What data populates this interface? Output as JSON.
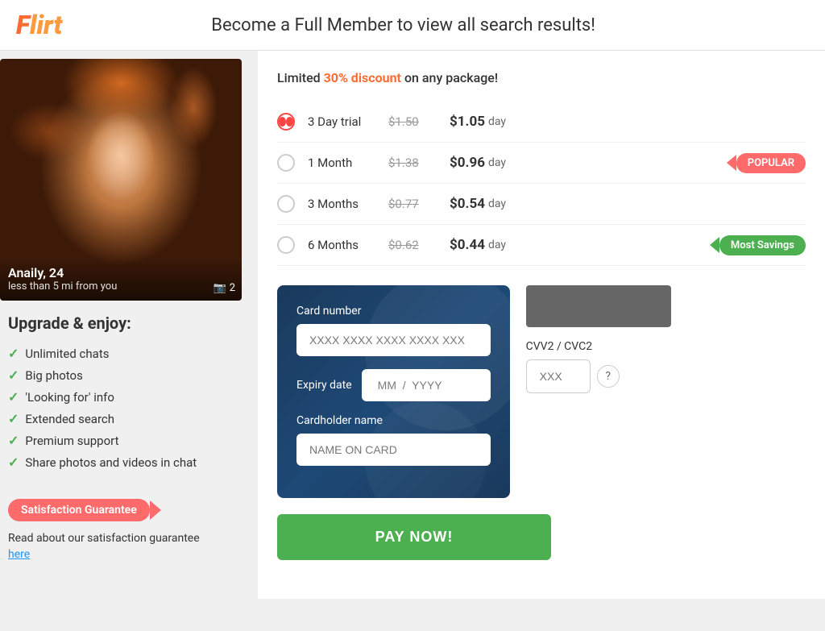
{
  "header": {
    "logo_text_f": "F",
    "logo_text_rest": "lirt",
    "title": "Become a Full Member to view all search results!"
  },
  "profile": {
    "name": "Anaily, 24",
    "distance": "less than 5 mi from you",
    "photo_count": "2"
  },
  "upgrade": {
    "title": "Upgrade & enjoy:",
    "features": [
      "Unlimited chats",
      "Big photos",
      "'Looking for' info",
      "Extended search",
      "Premium support",
      "Share photos and videos in chat"
    ],
    "satisfaction_badge": "Satisfaction Guarantee",
    "satisfaction_text": "Read about our satisfaction guarantee",
    "satisfaction_link": "here"
  },
  "pricing": {
    "banner_text_1": "Limited ",
    "banner_discount": "30% discount",
    "banner_text_2": " on any package!",
    "plans": [
      {
        "id": "3day",
        "name": "3 Day trial",
        "original_price": "$1.50",
        "current_price": "$1.05",
        "per_day": "day",
        "selected": true,
        "badge": null
      },
      {
        "id": "1month",
        "name": "1 Month",
        "original_price": "$1.38",
        "current_price": "$0.96",
        "per_day": "day",
        "selected": false,
        "badge": "popular"
      },
      {
        "id": "3months",
        "name": "3 Months",
        "original_price": "$0.77",
        "current_price": "$0.54",
        "per_day": "day",
        "selected": false,
        "badge": null
      },
      {
        "id": "6months",
        "name": "6 Months",
        "original_price": "$0.62",
        "current_price": "$0.44",
        "per_day": "day",
        "selected": false,
        "badge": "savings"
      }
    ]
  },
  "payment": {
    "card_number_label": "Card number",
    "card_number_placeholder": "XXXX XXXX XXXX XXXX XXX",
    "expiry_label": "Expiry date",
    "expiry_placeholder": "MM  /  YYYY",
    "cardholder_label": "Cardholder name",
    "cardholder_placeholder": "NAME ON CARD",
    "cvv_label": "CVV2 / CVC2",
    "cvv_placeholder": "XXX",
    "pay_button": "PAY NOW!"
  },
  "badges": {
    "popular": "POPULAR",
    "most_savings": "Most Savings"
  }
}
